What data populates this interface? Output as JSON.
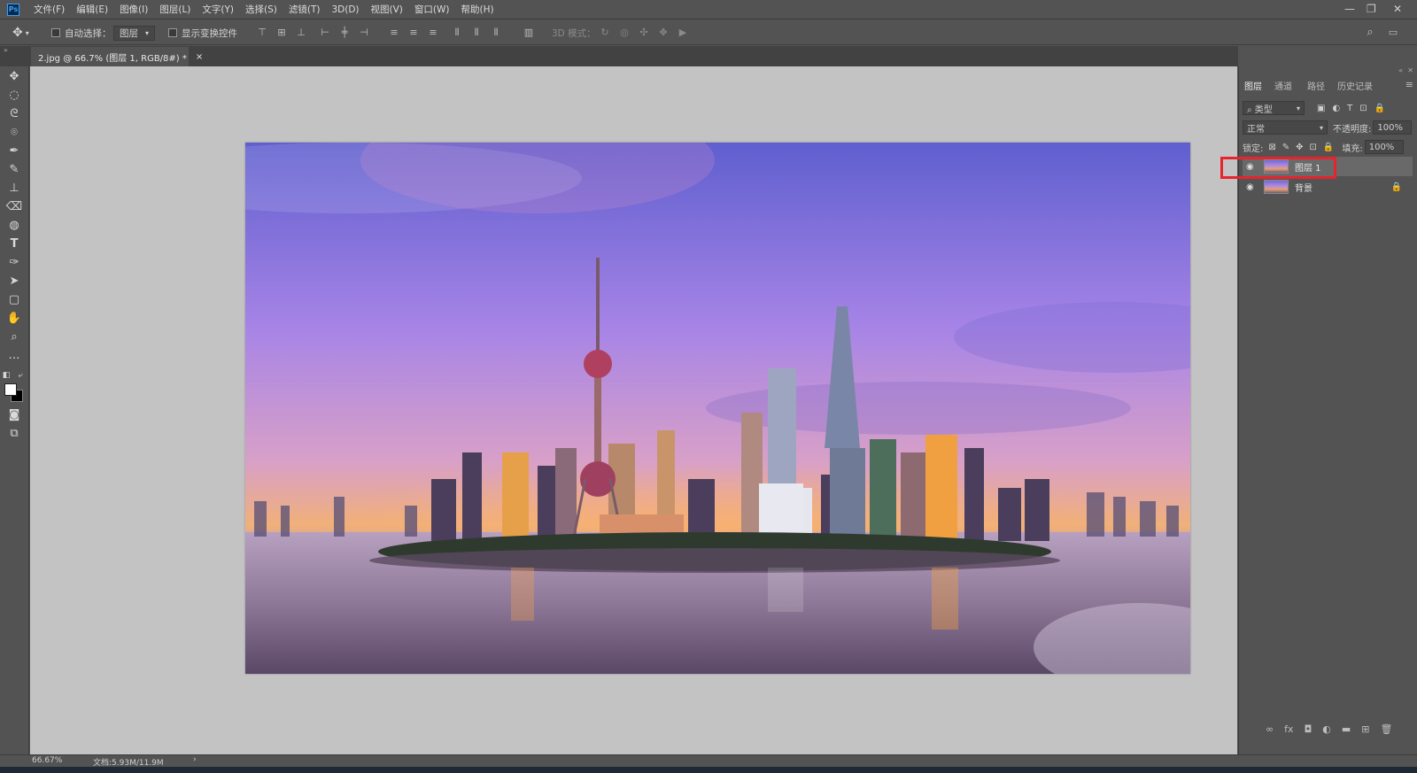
{
  "app": {
    "logo": "Ps"
  },
  "menu": [
    "文件(F)",
    "编辑(E)",
    "图像(I)",
    "图层(L)",
    "文字(Y)",
    "选择(S)",
    "滤镜(T)",
    "3D(D)",
    "视图(V)",
    "窗口(W)",
    "帮助(H)"
  ],
  "options": {
    "auto_select_label": "自动选择：",
    "auto_select_value": "图层",
    "show_transform_label": "显示变换控件",
    "mode_3d_label": "3D 模式："
  },
  "document_tab": {
    "title": "2.jpg @ 66.7% (图层 1, RGB/8#) *",
    "close": "×"
  },
  "panel": {
    "tabs": [
      "图层",
      "通道",
      "路径",
      "历史记录"
    ],
    "filter_kind": "类型",
    "blend_mode": "正常",
    "opacity_label": "不透明度:",
    "opacity_value": "100%",
    "lock_label": "锁定:",
    "fill_label": "填充:",
    "fill_value": "100%",
    "layers": [
      {
        "name": "图层 1",
        "selected": true,
        "locked": false
      },
      {
        "name": "背景",
        "selected": false,
        "locked": true
      }
    ],
    "footer_fx": "fx"
  },
  "status": {
    "zoom": "66.67%",
    "doc_size": "文档:5.93M/11.9M",
    "arrow": "›"
  },
  "colors": {
    "highlight": "#e8232b",
    "canvas_bg": "#c3c3c3"
  },
  "icons": [
    "move-icon",
    "marquee-icon",
    "lasso-icon",
    "quick-select-icon",
    "eyedropper-icon",
    "brush-icon",
    "stamp-icon",
    "eraser-icon",
    "blur-icon",
    "type-icon",
    "pen-icon",
    "path-select-icon",
    "shape-icon",
    "hand-icon",
    "zoom-icon",
    "more-icon",
    "eye-icon",
    "lock-icon",
    "search-icon"
  ]
}
